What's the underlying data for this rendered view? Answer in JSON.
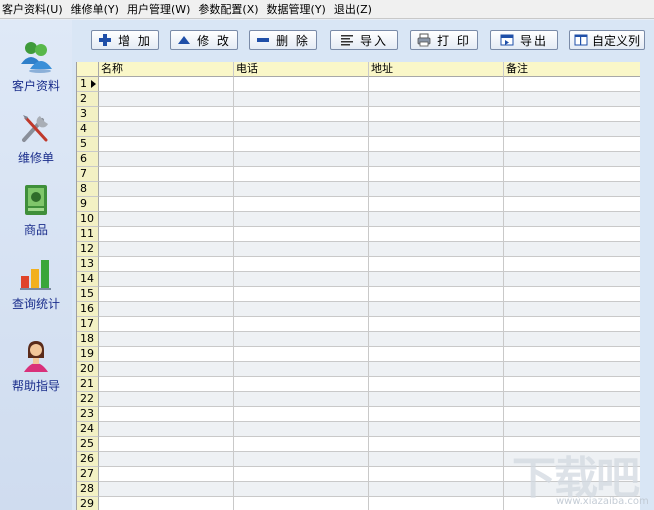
{
  "menu": [
    "客户资料(U)",
    "维修单(Y)",
    "用户管理(W)",
    "参数配置(X)",
    "数据管理(Y)",
    "退出(Z)"
  ],
  "sidebar": {
    "items": [
      {
        "label": "客户资料",
        "icon": "users-icon"
      },
      {
        "label": "维修单",
        "icon": "tools-icon"
      },
      {
        "label": "商品",
        "icon": "product-box-icon"
      },
      {
        "label": "查询统计",
        "icon": "bar-chart-icon"
      },
      {
        "label": "帮助指导",
        "icon": "help-person-icon"
      }
    ]
  },
  "toolbar": {
    "add_label": "增 加",
    "edit_label": "修 改",
    "delete_label": "删 除",
    "import_label": "导入",
    "print_label": "打 印",
    "export_label": "导出",
    "custom_columns_label": "自定义列"
  },
  "grid": {
    "columns": [
      "名称",
      "电话",
      "地址",
      "备注"
    ],
    "rows": [
      "1",
      "2",
      "3",
      "4",
      "5",
      "6",
      "7",
      "8",
      "9",
      "10",
      "11",
      "12",
      "13",
      "14",
      "15",
      "16",
      "17",
      "18",
      "19",
      "20",
      "21",
      "22",
      "23",
      "24",
      "25",
      "26",
      "27",
      "28",
      "29"
    ],
    "selected_row": "1"
  },
  "watermark": {
    "text": "下载吧",
    "url": "www.xiazaiba.com"
  },
  "colors": {
    "header_bg": "#faf7c8",
    "rownum_bg": "#f3f1c4",
    "sidebar_text": "#1b2e8c",
    "main_bg": "#d9e6f5"
  }
}
